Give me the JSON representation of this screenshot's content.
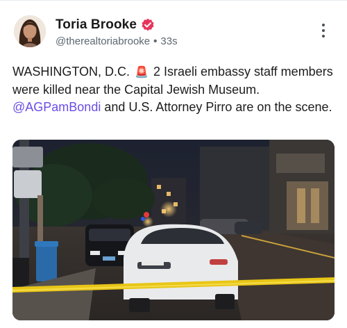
{
  "author": {
    "display_name": "Toria Brooke",
    "handle": "@therealtoriabrooke",
    "separator": "•",
    "timestamp": "33s",
    "verified_color": "#e8345c"
  },
  "post": {
    "text_part1": "WASHINGTON, D.C. ",
    "siren": "🚨",
    "text_part2": " 2 Israeli embassy staff members were killed near the Capital Jewish Museum. ",
    "mention": "@AGPamBondi",
    "text_part3": " and U.S. Attorney Pirro are on the scene."
  },
  "media": {
    "icon": "night-street-photo"
  },
  "colors": {
    "mention": "#6a4de6",
    "caution_tape": "#e8c617"
  }
}
